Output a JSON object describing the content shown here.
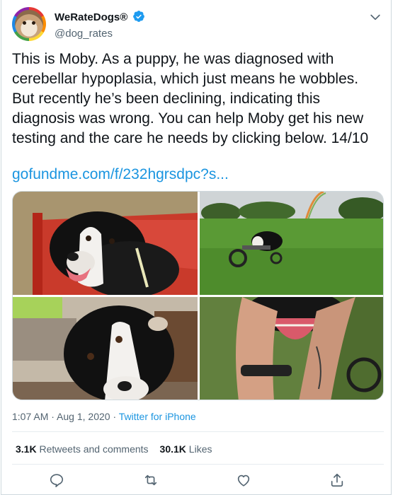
{
  "user": {
    "display_name": "WeRateDogs®",
    "handle": "@dog_rates",
    "verified": true
  },
  "tweet": {
    "text": "This is Moby. As a puppy, he was diagnosed with cerebellar hypoplasia, which just means he wobbles. But recently he’s been declining, indicating this diagnosis was wrong. You can help Moby get his new testing and the care he needs by clicking below. 14/10",
    "link": "gofundme.com/f/232hgrsdpc?s...",
    "photo_count": 4
  },
  "meta": {
    "time": "1:07 AM",
    "separator": " · ",
    "date": "Aug 1, 2020",
    "source": "Twitter for iPhone"
  },
  "stats": {
    "retweets_count": "3.1K",
    "retweets_label": "Retweets and comments",
    "likes_count": "30.1K",
    "likes_label": "Likes"
  },
  "icons": {
    "verified": "verified-badge-icon",
    "more": "chevron-down-icon",
    "reply": "reply-icon",
    "retweet": "retweet-icon",
    "like": "heart-icon",
    "share": "share-icon"
  },
  "colors": {
    "link": "#1b95e0",
    "verified": "#1d9bf0",
    "secondary_text": "#536471"
  }
}
